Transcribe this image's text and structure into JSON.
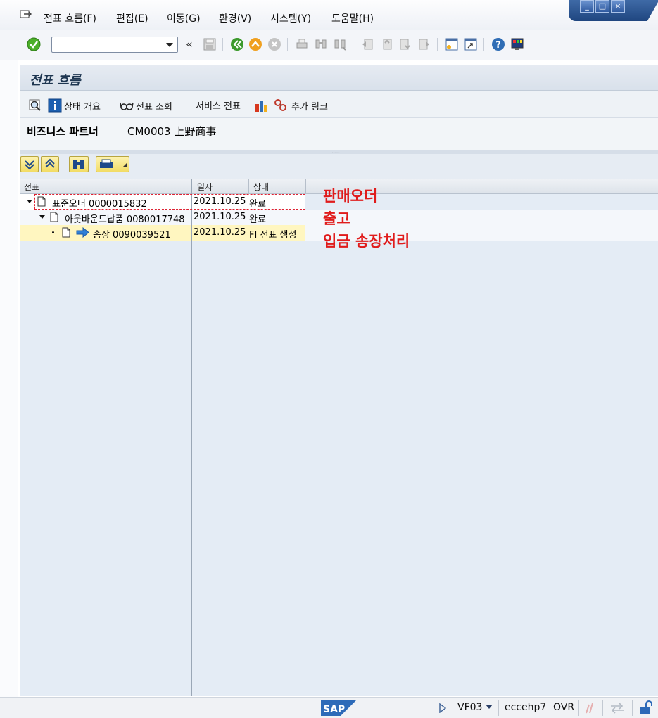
{
  "menu": {
    "items": [
      "전표 흐름(F)",
      "편집(E)",
      "이동(G)",
      "환경(V)",
      "시스템(Y)",
      "도움말(H)"
    ]
  },
  "toolbar": {
    "command_value": "",
    "icons": [
      "enter-icon",
      "save-icon",
      "back-icon",
      "exit-icon",
      "cancel-icon",
      "print-icon",
      "find-icon",
      "find-next-icon",
      "first-page-icon",
      "prev-page-icon",
      "next-page-icon",
      "last-page-icon",
      "new-session-icon",
      "shortcut-icon",
      "help-icon",
      "layout-icon"
    ]
  },
  "title": "전표 흐름",
  "app_toolbar": {
    "status_overview": "상태 개요",
    "display_document": "전표 조회",
    "service_document": "서비스 전표",
    "additional_links": "추가 링크"
  },
  "business_partner": {
    "label": "비즈니스 파트너",
    "value": "CM0003 上野商事"
  },
  "tree": {
    "columns": [
      "전표",
      "일자",
      "상태"
    ],
    "rows": [
      {
        "name": "표준오더 0000015832",
        "date": "2021.10.25",
        "status": "완료"
      },
      {
        "name": "아웃바운드납품 0080017748",
        "date": "2021.10.25",
        "status": "완료"
      },
      {
        "name": "송장 0090039521",
        "date": "2021.10.25",
        "status": "FI 전표 생성"
      }
    ]
  },
  "annotations": [
    "판매오더",
    "출고",
    "입금 송장처리"
  ],
  "status_bar": {
    "transaction": "VF03",
    "server": "eccehp7",
    "mode": "OVR"
  },
  "colors": {
    "annotation": "#e01b1b",
    "highlight_row": "#fff6c0",
    "tree_bg": "#e4ecf5"
  }
}
